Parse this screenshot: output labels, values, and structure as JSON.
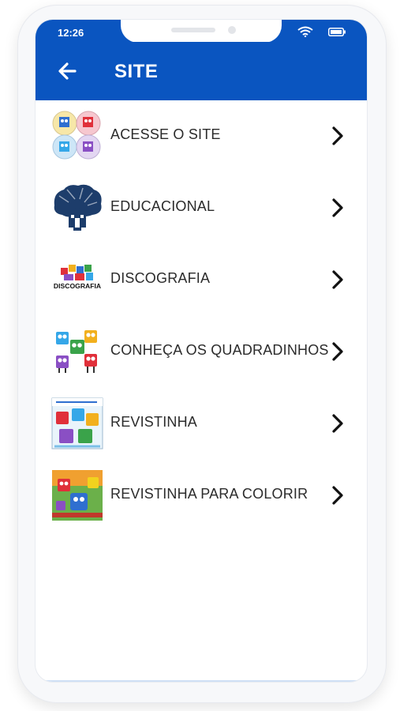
{
  "status_bar": {
    "time": "12:26",
    "icons": [
      "wifi-icon",
      "battery-icon"
    ]
  },
  "app_bar": {
    "title": "SITE",
    "back_icon": "arrow-left-icon",
    "background": "#0a55c0"
  },
  "menu": {
    "items": [
      {
        "label": "ACESSE O SITE",
        "icon": "quadradinhos-characters-thumbnail"
      },
      {
        "label": "EDUCACIONAL",
        "icon": "tree-house-icon"
      },
      {
        "label": "DISCOGRAFIA",
        "icon": "discografia-logo"
      },
      {
        "label": "CONHEÇA OS QUADRADINHOS",
        "icon": "characters-group-thumbnail"
      },
      {
        "label": "REVISTINHA",
        "icon": "comic-cover-thumbnail"
      },
      {
        "label": "REVISTINHA PARA COLORIR",
        "icon": "coloring-book-cover-thumbnail"
      }
    ],
    "chevron_icon": "chevron-right-icon"
  },
  "logos": {
    "discografia_text": "DISCOGRAFIA"
  }
}
